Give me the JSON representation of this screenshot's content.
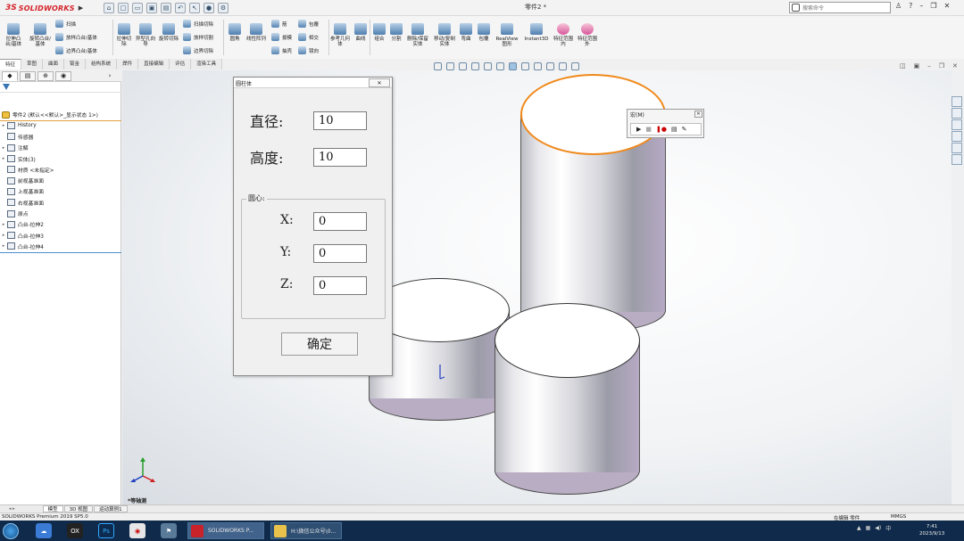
{
  "app": {
    "logo_prefix": "3S",
    "logo_name": "SOLIDWORKS",
    "document_title": "零件2 *",
    "search_placeholder": "搜索命令",
    "help_label": "?"
  },
  "ribbon": {
    "large_buttons": [
      "拉伸凸台/基体",
      "旋转凸台/基体",
      "拉伸切除",
      "异型孔向导",
      "旋转切除",
      "圆角",
      "线性阵列",
      "参考几何体",
      "曲线",
      "组合",
      "分割",
      "删除/保留实体",
      "移动/复制实体",
      "弯曲",
      "包覆",
      "RealView 图形",
      "Instant3D",
      "特征范围内",
      "特征范围外"
    ],
    "small_rows": [
      "扫描",
      "放样凸台/基体",
      "边界凸台/基体",
      "扫描切除",
      "放样切割",
      "边界切除",
      "筋",
      "拔模",
      "抽壳",
      "包覆",
      "相交",
      "镜向"
    ]
  },
  "command_tabs": [
    "特征",
    "草图",
    "曲面",
    "钣金",
    "结构系统",
    "焊件",
    "直接编辑",
    "评估",
    "渲染工具"
  ],
  "feature_tree": {
    "root": "零件2 (默认<<默认>_显示状态 1>)",
    "items": [
      "History",
      "传感器",
      "注解",
      "实体(3)",
      "材质 <未指定>",
      "前视基准面",
      "上视基准面",
      "右视基准面",
      "原点",
      "凸台-拉伸2",
      "凸台-拉伸3",
      "凸台-拉伸4"
    ]
  },
  "dialog": {
    "title": "圆柱体",
    "close": "✕",
    "diameter_label": "直径:",
    "diameter_value": "10",
    "height_label": "高度:",
    "height_value": "10",
    "center_group": "圆心:",
    "x_label": "X:",
    "x_value": "0",
    "y_label": "Y:",
    "y_value": "0",
    "z_label": "Z:",
    "z_value": "0",
    "ok_label": "确定"
  },
  "macro_toolbar": {
    "title": "宏(M)",
    "close": "✕"
  },
  "viewport": {
    "view_label": "*等轴测"
  },
  "bottom_tabs": [
    "模型",
    "3D 视图",
    "运动算例1"
  ],
  "status": {
    "version": "SOLIDWORKS Premium 2019 SP5.0",
    "mode": "在编辑 零件",
    "units": "MMGS"
  },
  "taskbar": {
    "tasks": [
      "SOLIDWORKS P...",
      "H:\\微信公众号\\0..."
    ],
    "time": "7:41",
    "date": "2023/9/13"
  },
  "colors": {
    "accent": "#f0891a",
    "brand": "#d4242a",
    "taskbar": "#0f2a4a"
  }
}
